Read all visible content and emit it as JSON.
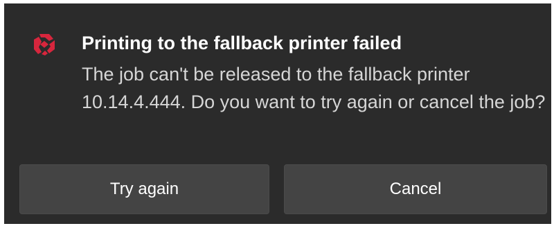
{
  "notification": {
    "title": "Printing to the fallback printer failed",
    "message": "The job can't be released to the fallback printer 10.14.4.444. Do you want to try again or cancel the job?",
    "app_icon": "kyocera-logo-icon",
    "colors": {
      "background": "#2b2b2b",
      "accent": "#d7263d",
      "button": "#444444"
    }
  },
  "actions": {
    "try_again_label": "Try again",
    "cancel_label": "Cancel"
  }
}
